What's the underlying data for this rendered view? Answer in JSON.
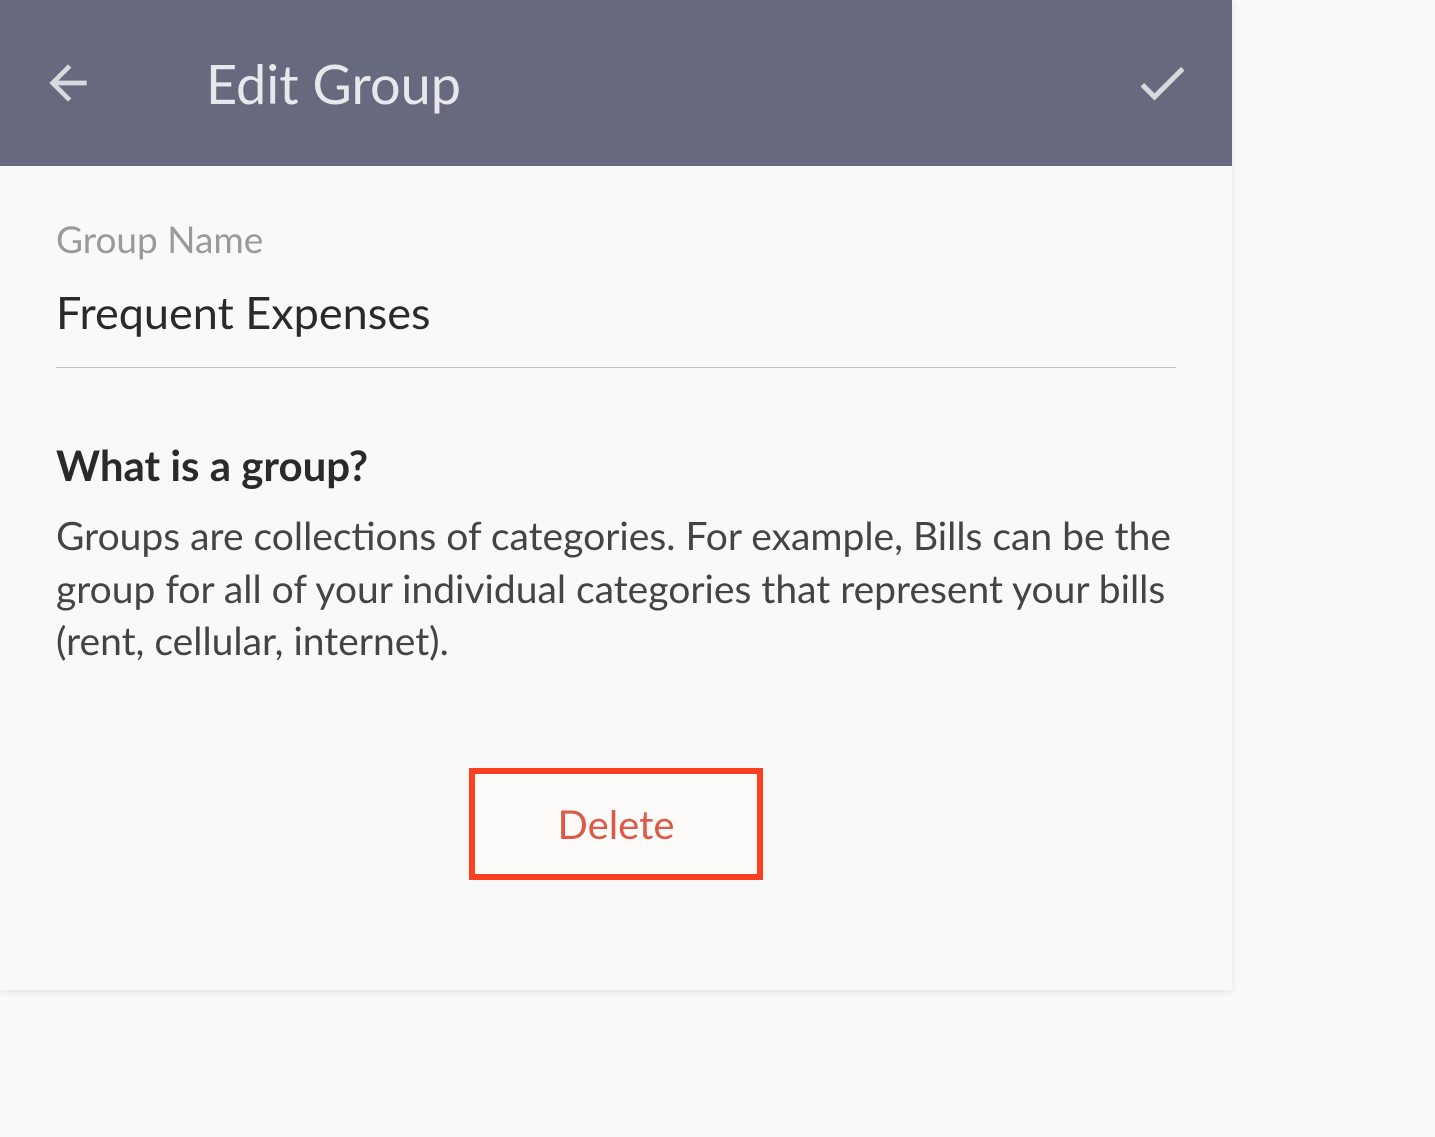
{
  "header": {
    "title": "Edit Group"
  },
  "form": {
    "group_name_label": "Group Name",
    "group_name_value": "Frequent Expenses"
  },
  "info": {
    "heading": "What is a group?",
    "body": "Groups are collections of categories. For example, Bills can be the group for all of your individual categories that represent your bills (rent, cellular, internet)."
  },
  "actions": {
    "delete_label": "Delete"
  }
}
